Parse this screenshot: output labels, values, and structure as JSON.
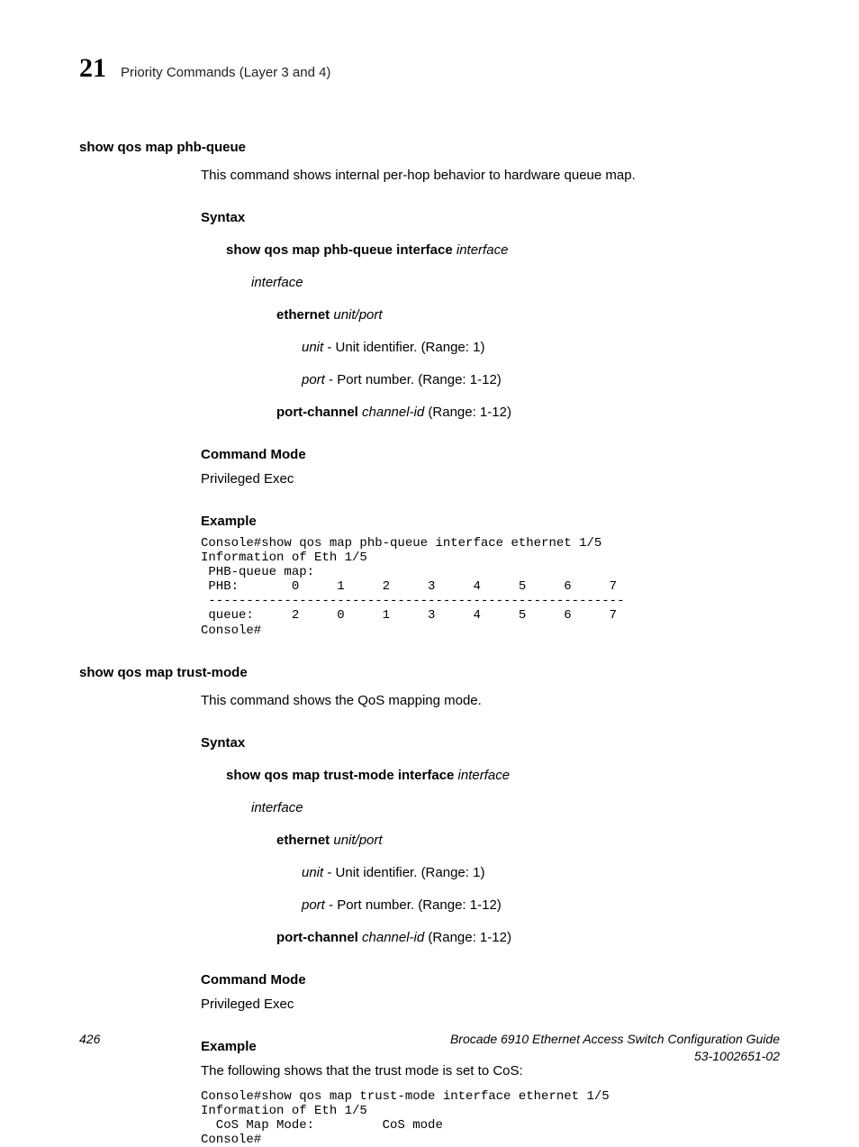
{
  "header": {
    "chapter_number": "21",
    "chapter_title": "Priority Commands (Layer 3 and 4)"
  },
  "sections": [
    {
      "title": "show qos map phb-queue",
      "intro": "This command shows internal per-hop behavior to hardware queue map.",
      "syntax_heading": "Syntax",
      "syntax_cmd_bold": "show qos map phb-queue interface",
      "syntax_cmd_ital": "interface",
      "param_interface": "interface",
      "param_eth_bold": "ethernet",
      "param_eth_ital1": "unit",
      "param_eth_sep": "/",
      "param_eth_ital2": "port",
      "param_unit_ital": "unit",
      "param_unit_text": " - Unit identifier. (Range: 1)",
      "param_port_ital": "port",
      "param_port_text": " - Port number. (Range: 1-12)",
      "param_pc_bold": "port-channel",
      "param_pc_ital": "channel-id",
      "param_pc_text": " (Range: 1-12)",
      "cmdmode_heading": "Command Mode",
      "cmdmode_text": "Privileged Exec",
      "example_heading": "Example",
      "code": "Console#show qos map phb-queue interface ethernet 1/5\nInformation of Eth 1/5\n PHB-queue map:\n PHB:       0     1     2     3     4     5     6     7\n -------------------------------------------------------\n queue:     2     0     1     3     4     5     6     7\nConsole#"
    },
    {
      "title": "show qos map trust-mode",
      "intro": "This command shows the QoS mapping mode.",
      "syntax_heading": "Syntax",
      "syntax_cmd_bold": "show qos map trust-mode interface",
      "syntax_cmd_ital": "interface",
      "param_interface": "interface",
      "param_eth_bold": "ethernet",
      "param_eth_ital1": "unit",
      "param_eth_sep": "/",
      "param_eth_ital2": "port",
      "param_unit_ital": "unit",
      "param_unit_text": " - Unit identifier. (Range: 1)",
      "param_port_ital": "port",
      "param_port_text": " - Port number. (Range: 1-12)",
      "param_pc_bold": "port-channel",
      "param_pc_ital": "channel-id",
      "param_pc_text": " (Range: 1-12)",
      "cmdmode_heading": "Command Mode",
      "cmdmode_text": "Privileged Exec",
      "example_heading": "Example",
      "example_note": "The following shows that the trust mode is set to CoS:",
      "code": "Console#show qos map trust-mode interface ethernet 1/5\nInformation of Eth 1/5\n  CoS Map Mode:         CoS mode\nConsole#"
    }
  ],
  "footer": {
    "page_number": "426",
    "guide": "Brocade 6910 Ethernet Access Switch Configuration Guide",
    "docnum": "53-1002651-02"
  }
}
